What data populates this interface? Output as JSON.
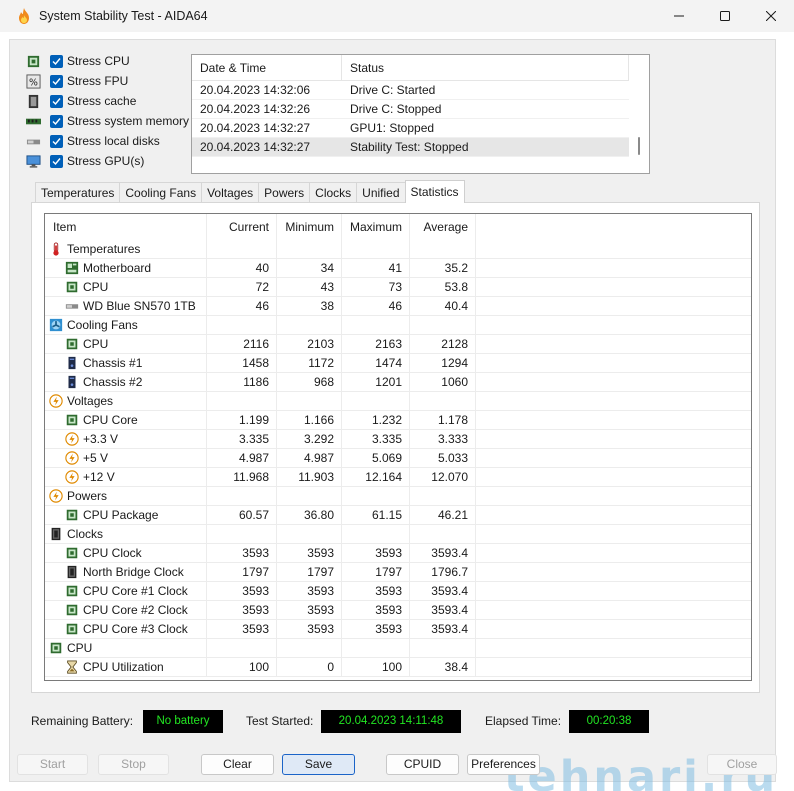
{
  "window": {
    "title": "System Stability Test - AIDA64"
  },
  "stress": [
    {
      "label": "Stress CPU",
      "checked": true,
      "icon": "cpu-chip-icon"
    },
    {
      "label": "Stress FPU",
      "checked": true,
      "icon": "fpu-percent-icon"
    },
    {
      "label": "Stress cache",
      "checked": true,
      "icon": "cache-chip-icon"
    },
    {
      "label": "Stress system memory",
      "checked": true,
      "icon": "memory-module-icon"
    },
    {
      "label": "Stress local disks",
      "checked": true,
      "icon": "disk-drive-icon"
    },
    {
      "label": "Stress GPU(s)",
      "checked": true,
      "icon": "monitor-icon"
    }
  ],
  "log": {
    "columns": [
      "Date & Time",
      "Status"
    ],
    "rows": [
      {
        "time": "20.04.2023 14:32:06",
        "status": "Drive C: Started"
      },
      {
        "time": "20.04.2023 14:32:26",
        "status": "Drive C: Stopped"
      },
      {
        "time": "20.04.2023 14:32:27",
        "status": "GPU1: Stopped"
      },
      {
        "time": "20.04.2023 14:32:27",
        "status": "Stability Test: Stopped"
      }
    ],
    "selected_index": 3
  },
  "tabs": [
    {
      "label": "Temperatures"
    },
    {
      "label": "Cooling Fans"
    },
    {
      "label": "Voltages"
    },
    {
      "label": "Powers"
    },
    {
      "label": "Clocks"
    },
    {
      "label": "Unified"
    },
    {
      "label": "Statistics"
    }
  ],
  "active_tab": "Statistics",
  "stats": {
    "columns": [
      "Item",
      "Current",
      "Minimum",
      "Maximum",
      "Average"
    ],
    "rows": [
      {
        "type": "group",
        "name": "Temperatures",
        "icon": "thermometer-icon"
      },
      {
        "type": "item",
        "name": "Motherboard",
        "icon": "motherboard-icon",
        "cur": "40",
        "min": "34",
        "max": "41",
        "avg": "35.2"
      },
      {
        "type": "item",
        "name": "CPU",
        "icon": "cpu-chip-icon",
        "cur": "72",
        "min": "43",
        "max": "73",
        "avg": "53.8"
      },
      {
        "type": "item",
        "name": "WD Blue SN570 1TB",
        "icon": "disk-drive-icon",
        "cur": "46",
        "min": "38",
        "max": "46",
        "avg": "40.4"
      },
      {
        "type": "group",
        "name": "Cooling Fans",
        "icon": "fan-icon"
      },
      {
        "type": "item",
        "name": "CPU",
        "icon": "cpu-chip-icon",
        "cur": "2116",
        "min": "2103",
        "max": "2163",
        "avg": "2128"
      },
      {
        "type": "item",
        "name": "Chassis #1",
        "icon": "chassis-icon",
        "cur": "1458",
        "min": "1172",
        "max": "1474",
        "avg": "1294"
      },
      {
        "type": "item",
        "name": "Chassis #2",
        "icon": "chassis-icon",
        "cur": "1186",
        "min": "968",
        "max": "1201",
        "avg": "1060"
      },
      {
        "type": "group",
        "name": "Voltages",
        "icon": "lightning-icon"
      },
      {
        "type": "item",
        "name": "CPU Core",
        "icon": "cpu-chip-icon",
        "cur": "1.199",
        "min": "1.166",
        "max": "1.232",
        "avg": "1.178"
      },
      {
        "type": "item",
        "name": "+3.3 V",
        "icon": "lightning-icon",
        "cur": "3.335",
        "min": "3.292",
        "max": "3.335",
        "avg": "3.333"
      },
      {
        "type": "item",
        "name": "+5 V",
        "icon": "lightning-icon",
        "cur": "4.987",
        "min": "4.987",
        "max": "5.069",
        "avg": "5.033"
      },
      {
        "type": "item",
        "name": "+12 V",
        "icon": "lightning-icon",
        "cur": "11.968",
        "min": "11.903",
        "max": "12.164",
        "avg": "12.070"
      },
      {
        "type": "group",
        "name": "Powers",
        "icon": "lightning-icon"
      },
      {
        "type": "item",
        "name": "CPU Package",
        "icon": "cpu-chip-icon",
        "cur": "60.57",
        "min": "36.80",
        "max": "61.15",
        "avg": "46.21"
      },
      {
        "type": "group",
        "name": "Clocks",
        "icon": "clock-chip-icon"
      },
      {
        "type": "item",
        "name": "CPU Clock",
        "icon": "cpu-chip-icon",
        "cur": "3593",
        "min": "3593",
        "max": "3593",
        "avg": "3593.4"
      },
      {
        "type": "item",
        "name": "North Bridge Clock",
        "icon": "clock-chip-icon",
        "cur": "1797",
        "min": "1797",
        "max": "1797",
        "avg": "1796.7"
      },
      {
        "type": "item",
        "name": "CPU Core #1 Clock",
        "icon": "cpu-chip-icon",
        "cur": "3593",
        "min": "3593",
        "max": "3593",
        "avg": "3593.4"
      },
      {
        "type": "item",
        "name": "CPU Core #2 Clock",
        "icon": "cpu-chip-icon",
        "cur": "3593",
        "min": "3593",
        "max": "3593",
        "avg": "3593.4"
      },
      {
        "type": "item",
        "name": "CPU Core #3 Clock",
        "icon": "cpu-chip-icon",
        "cur": "3593",
        "min": "3593",
        "max": "3593",
        "avg": "3593.4"
      },
      {
        "type": "group",
        "name": "CPU",
        "icon": "cpu-chip-icon"
      },
      {
        "type": "item",
        "name": "CPU Utilization",
        "icon": "hourglass-icon",
        "cur": "100",
        "min": "0",
        "max": "100",
        "avg": "38.4"
      }
    ]
  },
  "status": {
    "battery_label": "Remaining Battery:",
    "battery_value": "No battery",
    "started_label": "Test Started:",
    "started_value": "20.04.2023 14:11:48",
    "elapsed_label": "Elapsed Time:",
    "elapsed_value": "00:20:38"
  },
  "buttons": {
    "start": "Start",
    "stop": "Stop",
    "clear": "Clear",
    "save": "Save",
    "cpuid": "CPUID",
    "preferences": "Preferences",
    "close": "Close"
  },
  "watermark": "tehnari.ru"
}
